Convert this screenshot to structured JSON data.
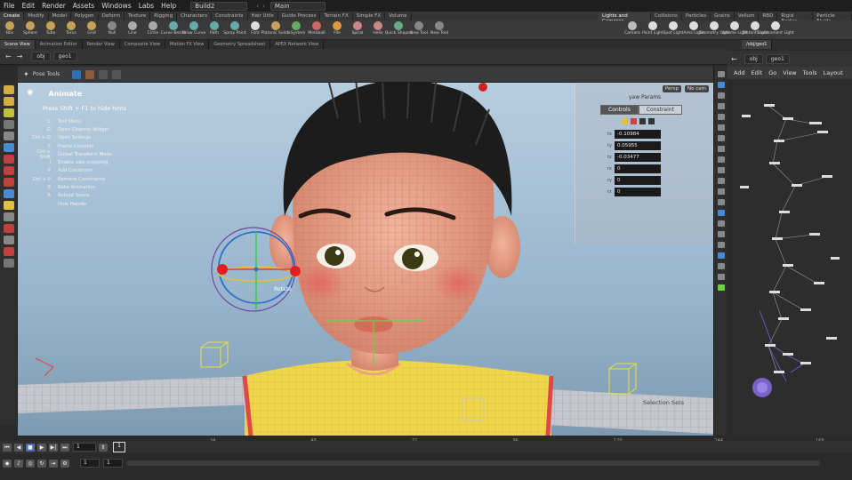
{
  "menubar": {
    "items": [
      "File",
      "Edit",
      "Render",
      "Assets",
      "Windows",
      "Labs",
      "Help"
    ],
    "desktop": "Build2",
    "scene": "Main"
  },
  "shelf_tabs_left": [
    "Create",
    "Modify",
    "Model",
    "Polygon",
    "Deform",
    "Texture",
    "Rigging",
    "Characters",
    "Constraints",
    "Hair Utils",
    "Guide Process",
    "Terrain FX",
    "Simple FX",
    "Volume"
  ],
  "shelf_tabs_right": [
    "Lights and Cameras",
    "Collisions",
    "Particles",
    "Grains",
    "Vellum",
    "RBD",
    "Rigid Bodies",
    "Particle Fluids"
  ],
  "shelf_tools_left": [
    {
      "label": "Box",
      "color": "#c9a25a"
    },
    {
      "label": "Sphere",
      "color": "#c9a25a"
    },
    {
      "label": "Tube",
      "color": "#c9a25a"
    },
    {
      "label": "Torus",
      "color": "#c9a25a"
    },
    {
      "label": "Grid",
      "color": "#c9a25a"
    },
    {
      "label": "Null",
      "color": "#888"
    },
    {
      "label": "Line",
      "color": "#aaa"
    },
    {
      "label": "Circle",
      "color": "#aaa"
    },
    {
      "label": "Curve Bezier",
      "color": "#6aa"
    },
    {
      "label": "Draw Curve",
      "color": "#6aa"
    },
    {
      "label": "Path",
      "color": "#6aa"
    },
    {
      "label": "Spray Paint",
      "color": "#6aa"
    },
    {
      "label": "Font",
      "color": "#ddd"
    },
    {
      "label": "Platonic Solids",
      "color": "#c9a25a"
    },
    {
      "label": "L-System",
      "color": "#6a6"
    },
    {
      "label": "Metaball",
      "color": "#c66"
    },
    {
      "label": "File",
      "color": "#d94"
    },
    {
      "label": "Spiral",
      "color": "#c88"
    },
    {
      "label": "Helix",
      "color": "#c88"
    },
    {
      "label": "Quick Shapes",
      "color": "#6a8"
    },
    {
      "label": "New Tool",
      "color": "#888"
    },
    {
      "label": "New Tool",
      "color": "#888"
    }
  ],
  "shelf_tools_right": [
    {
      "label": "Camera",
      "color": "#bbb"
    },
    {
      "label": "Point Light",
      "color": "#ddd"
    },
    {
      "label": "Spot Light",
      "color": "#ddd"
    },
    {
      "label": "Area Light",
      "color": "#ddd"
    },
    {
      "label": "Geometry Light",
      "color": "#ddd"
    },
    {
      "label": "Volume Light",
      "color": "#ddd"
    },
    {
      "label": "Distant Light",
      "color": "#ddd"
    },
    {
      "label": "Environment Light",
      "color": "#ddd"
    }
  ],
  "pane_tabs": [
    "Scene View",
    "Animation Editor",
    "Render View",
    "Composite View",
    "Motion FX View",
    "Geometry Spreadsheet",
    "APEX Network View"
  ],
  "network_tab": "/obj/geo1",
  "viewport_path": [
    "obj",
    "geo1"
  ],
  "network_path": [
    "obj",
    "geo1"
  ],
  "network_menu": [
    "Add",
    "Edit",
    "Go",
    "View",
    "Tools",
    "Layout"
  ],
  "pose_tools_label": "Pose Tools",
  "hud": {
    "title": "Animate",
    "hint": "Press Shift + F1 to hide hints",
    "rows": [
      {
        "key": "C",
        "action": "Tool Menu"
      },
      {
        "key": "G",
        "action": "Open Channel Widget"
      },
      {
        "key": "Ctrl + G",
        "action": "Open Settings"
      },
      {
        "key": "F",
        "action": "Frame Controls"
      },
      {
        "key": "Ctrl + Shift",
        "action": "Global Transform Mode"
      },
      {
        "key": "I",
        "action": "Enable axis snapping"
      },
      {
        "key": "P",
        "action": "Add Constraint"
      },
      {
        "key": "Ctrl + P",
        "action": "Remove Constraints"
      },
      {
        "key": "B",
        "action": "Bake Animation"
      },
      {
        "key": "R",
        "action": "Reload Scene"
      },
      {
        "key": "",
        "action": "Hide Handle"
      }
    ]
  },
  "params": {
    "persp": "Persp",
    "cam": "No cam",
    "title": "yaw Params",
    "tab_controls": "Controls",
    "tab_constraint": "Constraint",
    "rows": [
      {
        "label": "tx",
        "value": "-0.10984"
      },
      {
        "label": "ty",
        "value": "0.05955"
      },
      {
        "label": "tz",
        "value": "-0.03477"
      },
      {
        "label": "rx",
        "value": "0"
      },
      {
        "label": "ry",
        "value": "0"
      },
      {
        "label": "rz",
        "value": "0"
      }
    ]
  },
  "rotate_label": "Rotate",
  "selection_sets_label": "Selection Sets",
  "timeline": {
    "current_frame": "1",
    "start": "1",
    "end": "1",
    "ticks": [
      "24",
      "48",
      "72",
      "96",
      "120",
      "144",
      "168"
    ]
  },
  "colors": {
    "accent": "#e8c94a",
    "selection": "#2e6fb8",
    "skin": "#e8a489",
    "shirt": "#f0d64a"
  }
}
